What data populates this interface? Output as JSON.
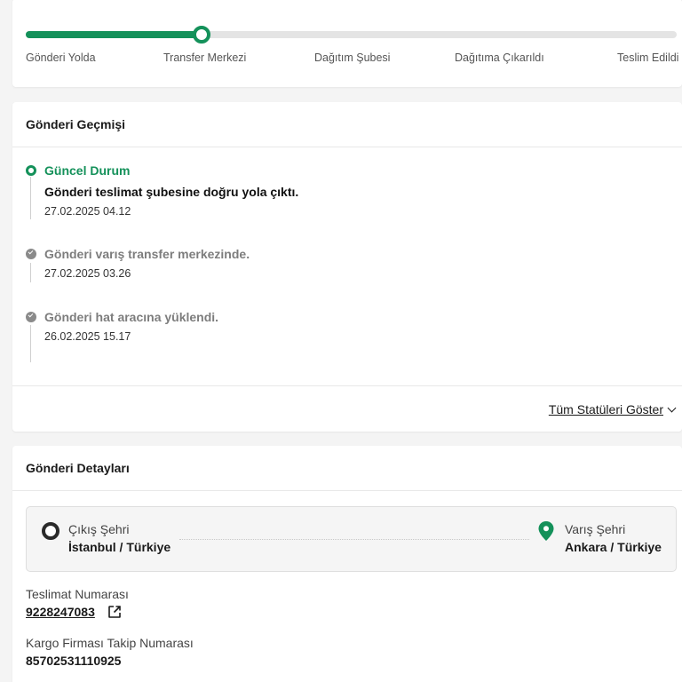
{
  "progress": {
    "steps": [
      {
        "label": "Gönderi Yolda"
      },
      {
        "label": "Transfer Merkezi"
      },
      {
        "label": "Dağıtım Şubesi"
      },
      {
        "label": "Dağıtıma Çıkarıldı"
      },
      {
        "label": "Teslim Edildi"
      }
    ],
    "current_step": 2,
    "total_steps": 5,
    "progress_fraction": 0.27,
    "accent_color": "#14915a",
    "track_color": "#e4e4e4"
  },
  "history": {
    "title": "Gönderi Geçmişi",
    "current_label": "Güncel Durum",
    "current_description": "Gönderi teslimat şubesine doğru yola çıktı.",
    "current_time": "27.02.2025 04.12",
    "items": [
      {
        "text": "Gönderi varış transfer merkezinde.",
        "time": "27.02.2025 03.26",
        "icon": "check-circle-icon"
      },
      {
        "text": "Gönderi hat aracına yüklendi.",
        "time": "26.02.2025 15.17",
        "icon": "check-circle-icon"
      }
    ],
    "show_all_label": "Tüm Statüleri Göster"
  },
  "details": {
    "title": "Gönderi Detayları",
    "origin": {
      "label": "Çıkış Şehri",
      "value": "İstanbul / Türkiye",
      "icon": "origin-circle-icon"
    },
    "destination": {
      "label": "Varış Şehri",
      "value": "Ankara / Türkiye",
      "icon": "map-pin-icon"
    },
    "delivery_number_label": "Teslimat Numarası",
    "delivery_number": "9228247083",
    "cargo_tracking_label": "Kargo Firması Takip Numarası",
    "cargo_tracking_number": "85702531110925"
  }
}
